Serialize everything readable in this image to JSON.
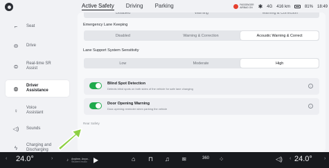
{
  "status": {
    "airbag_line1": "PASSENGER",
    "airbag_line2": "AIRBAG ON",
    "bluetooth_icon": "bluetooth-icon",
    "signal": "4G",
    "range": "416 km",
    "battery": "81%",
    "time": "18:49"
  },
  "tabs": [
    "Active Safety",
    "Driving",
    "Parking"
  ],
  "sidebar": {
    "items": [
      {
        "label": "Seat",
        "icon": "seat-icon"
      },
      {
        "label": "Drive",
        "icon": "steering-wheel-icon"
      },
      {
        "label": "Real-time SR Assist",
        "icon": "car-radar-icon"
      },
      {
        "label": "Driver Assistance",
        "icon": "driver-assist-icon"
      },
      {
        "label": "Voice Assistant",
        "icon": "microphone-icon"
      },
      {
        "label": "Sounds",
        "icon": "speaker-icon"
      },
      {
        "label": "Charging and Discharging",
        "icon": "charging-icon"
      }
    ]
  },
  "top_segment": [
    "Disabled",
    "Warning",
    "Warning & Correction"
  ],
  "lane_keeping": {
    "title": "Emergency Lane Keeping",
    "options": [
      "Disabled",
      "Warning & Correction",
      "Acoustic Warning & Correct"
    ],
    "selected": 2
  },
  "sensitivity": {
    "title": "Lane Support System Sensitivity",
    "options": [
      "Low",
      "Moderate",
      "High"
    ],
    "selected": 2
  },
  "blind_spot": {
    "title": "Blind Spot Detection",
    "subtitle": "Detects blind spots on both sides of the vehicle for safe lane changing",
    "enabled": true
  },
  "door_opening": {
    "title": "Door Opening Warning",
    "subtitle": "Door-opening reminder when parking the vehicle",
    "enabled": true
  },
  "rear_safety": "Rear Safety",
  "dock": {
    "temp_left": "24.0°",
    "temp_right": "24.0°",
    "media_line1": "Anytime, Anyw...",
    "media_line2": "Student music",
    "three_sixty": "360"
  },
  "colors": {
    "toggle_on": "#1fa94c",
    "airbag": "#e5402e",
    "arrow": "#8dd043"
  }
}
